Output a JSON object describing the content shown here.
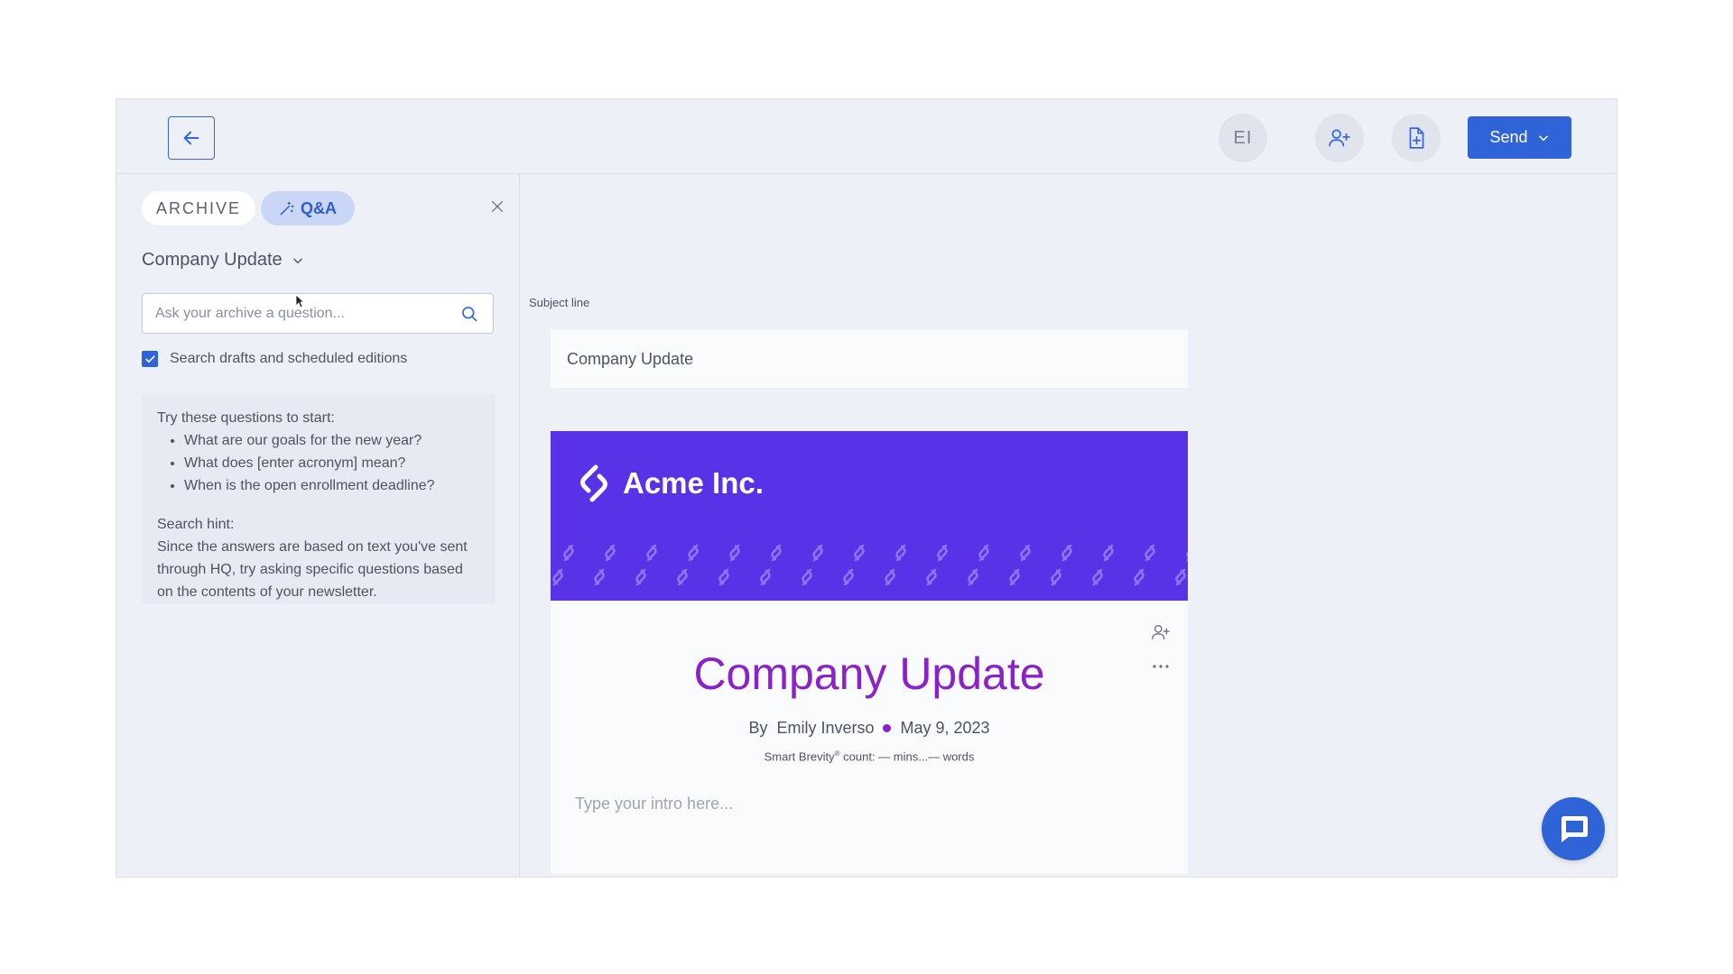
{
  "topbar": {
    "avatar_initials": "EI",
    "send_label": "Send"
  },
  "sidebar": {
    "tabs": [
      {
        "label": "ARCHIVE",
        "active": false
      },
      {
        "label": "Q&A",
        "active": true
      }
    ],
    "newsletter_selector": "Company Update",
    "search": {
      "placeholder": "Ask your archive a question...",
      "value": ""
    },
    "checkbox": {
      "label": "Search drafts and scheduled editions",
      "checked": true
    },
    "hint": {
      "intro": "Try these questions to start:",
      "questions": [
        "What are our goals for the new year?",
        "What does [enter acronym] mean?",
        "When is the open enrollment deadline?"
      ],
      "title": "Search hint:",
      "body": "Since the answers are based on text you've sent through HQ, try asking specific questions based on the contents of your newsletter."
    }
  },
  "editor": {
    "subject_label": "Subject line",
    "subject_value": "Company Update",
    "brand_name": "Acme Inc.",
    "title": "Company Update",
    "author_prefix": "By",
    "author": "Emily Inverso",
    "date": "May 9, 2023",
    "brevity_prefix": "Smart Brevity",
    "brevity_mark": "®",
    "brevity_suffix": " count: — mins...— words",
    "intro_placeholder": "Type your intro here..."
  },
  "colors": {
    "accent": "#2f63d8",
    "banner": "#5932e8",
    "title": "#8a21c9",
    "background": "#eef0f7"
  },
  "icons": [
    "arrow-left-icon",
    "user-plus-icon",
    "file-plus-icon",
    "chevron-down-icon",
    "wand-icon",
    "close-icon",
    "search-icon",
    "check-icon",
    "acme-logo-icon",
    "more-icon",
    "chat-icon"
  ]
}
